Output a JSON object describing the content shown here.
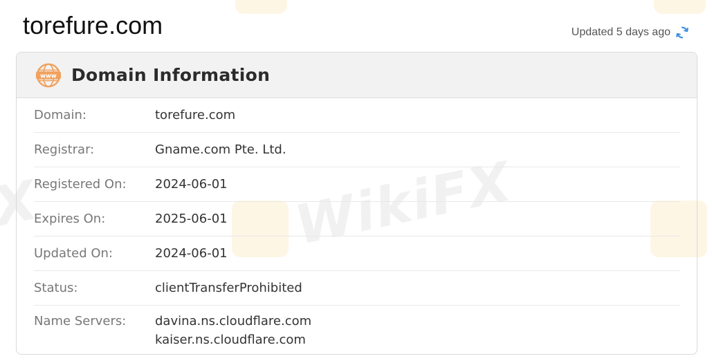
{
  "page": {
    "title": "torefure.com",
    "updated_text": "Updated 5 days ago"
  },
  "card": {
    "title": "Domain Information",
    "icon_text": "www",
    "rows": [
      {
        "label": "Domain:",
        "value": "torefure.com"
      },
      {
        "label": "Registrar:",
        "value": "Gname.com Pte. Ltd."
      },
      {
        "label": "Registered On:",
        "value": "2024-06-01"
      },
      {
        "label": "Expires On:",
        "value": "2025-06-01"
      },
      {
        "label": "Updated On:",
        "value": "2024-06-01"
      },
      {
        "label": "Status:",
        "value": "clientTransferProhibited"
      }
    ],
    "name_servers": {
      "label": "Name Servers:",
      "values": [
        "davina.ns.cloudflare.com",
        "kaiser.ns.cloudflare.com"
      ]
    }
  },
  "watermark": {
    "text": "WikiFX",
    "left_fragment": "X"
  },
  "colors": {
    "accent_orange": "#f0a15e",
    "refresh_blue": "#3b8ee0",
    "header_bg": "#f2f2f2",
    "border": "#d9d9d9"
  },
  "icons": {
    "header": "www-globe-icon",
    "refresh": "refresh-icon"
  }
}
